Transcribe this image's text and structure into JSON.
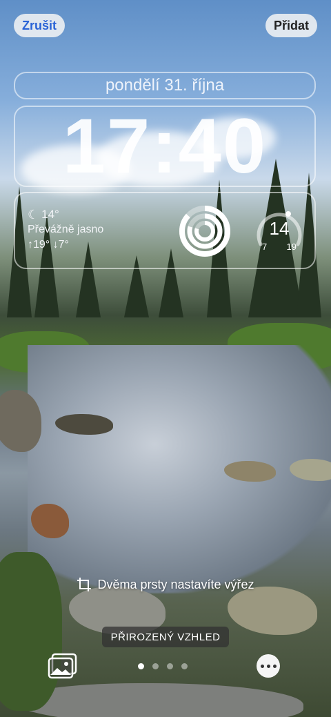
{
  "header": {
    "cancel_label": "Zrušit",
    "add_label": "Přidat"
  },
  "lockscreen": {
    "date": "pondělí 31. října",
    "time": "17:40"
  },
  "widgets": {
    "weather": {
      "icon": "moon-icon",
      "temp": "14°",
      "condition": "Převážně jasno",
      "high_low": "↑19° ↓7°"
    },
    "activity": {
      "icon": "activity-rings-icon"
    },
    "temperature_gauge": {
      "value": "14",
      "min": "7",
      "max": "19"
    }
  },
  "hint": {
    "icon": "crop-icon",
    "text": "Dvěma prsty nastavíte výřez"
  },
  "style_label": "PŘIROZENÝ VZHLED",
  "bottom": {
    "photos_icon": "photos-icon",
    "more_icon": "ellipsis-icon",
    "page_count": 4,
    "active_page": 1
  }
}
